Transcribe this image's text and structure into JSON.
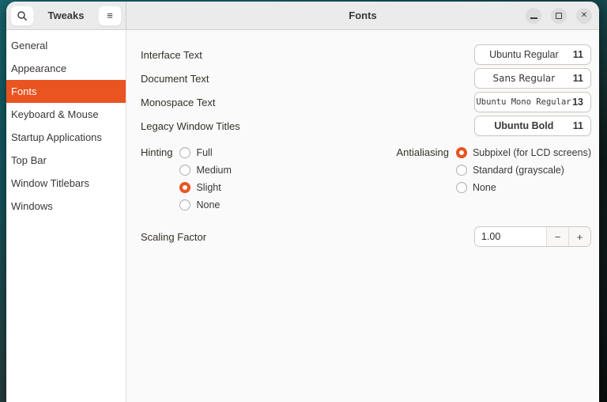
{
  "window": {
    "sidebar_title": "Tweaks",
    "header_title": "Fonts"
  },
  "icons": {
    "search_icon": "magnifier",
    "menu_icon": "≡",
    "minimize_icon": "horizontal-bar",
    "maximize_icon": "square-outline",
    "close_icon": "✕"
  },
  "sidebar": {
    "items": [
      {
        "label": "General",
        "selected": false
      },
      {
        "label": "Appearance",
        "selected": false
      },
      {
        "label": "Fonts",
        "selected": true
      },
      {
        "label": "Keyboard & Mouse",
        "selected": false
      },
      {
        "label": "Startup Applications",
        "selected": false
      },
      {
        "label": "Top Bar",
        "selected": false
      },
      {
        "label": "Window Titlebars",
        "selected": false
      },
      {
        "label": "Windows",
        "selected": false
      }
    ]
  },
  "content": {
    "font_rows": [
      {
        "label": "Interface Text",
        "font": "Ubuntu Regular",
        "size": "11"
      },
      {
        "label": "Document Text",
        "font": "Sans Regular",
        "size": "11"
      },
      {
        "label": "Monospace Text",
        "font": "Ubuntu Mono Regular",
        "size": "13"
      },
      {
        "label": "Legacy Window Titles",
        "font": "Ubuntu Bold",
        "size": "11"
      }
    ],
    "hinting": {
      "label": "Hinting",
      "options": [
        {
          "label": "Full",
          "selected": false
        },
        {
          "label": "Medium",
          "selected": false
        },
        {
          "label": "Slight",
          "selected": true
        },
        {
          "label": "None",
          "selected": false
        }
      ]
    },
    "antialiasing": {
      "label": "Antialiasing",
      "options": [
        {
          "label": "Subpixel (for LCD screens)",
          "selected": true
        },
        {
          "label": "Standard (grayscale)",
          "selected": false
        },
        {
          "label": "None",
          "selected": false
        }
      ]
    },
    "scaling": {
      "label": "Scaling Factor",
      "value": "1.00",
      "minus_label": "−",
      "plus_label": "+"
    }
  },
  "colors": {
    "accent": "#E95420",
    "titlebar": "#ebebeb",
    "sidebar_bg": "#ffffff",
    "content_bg": "#fafafa"
  }
}
